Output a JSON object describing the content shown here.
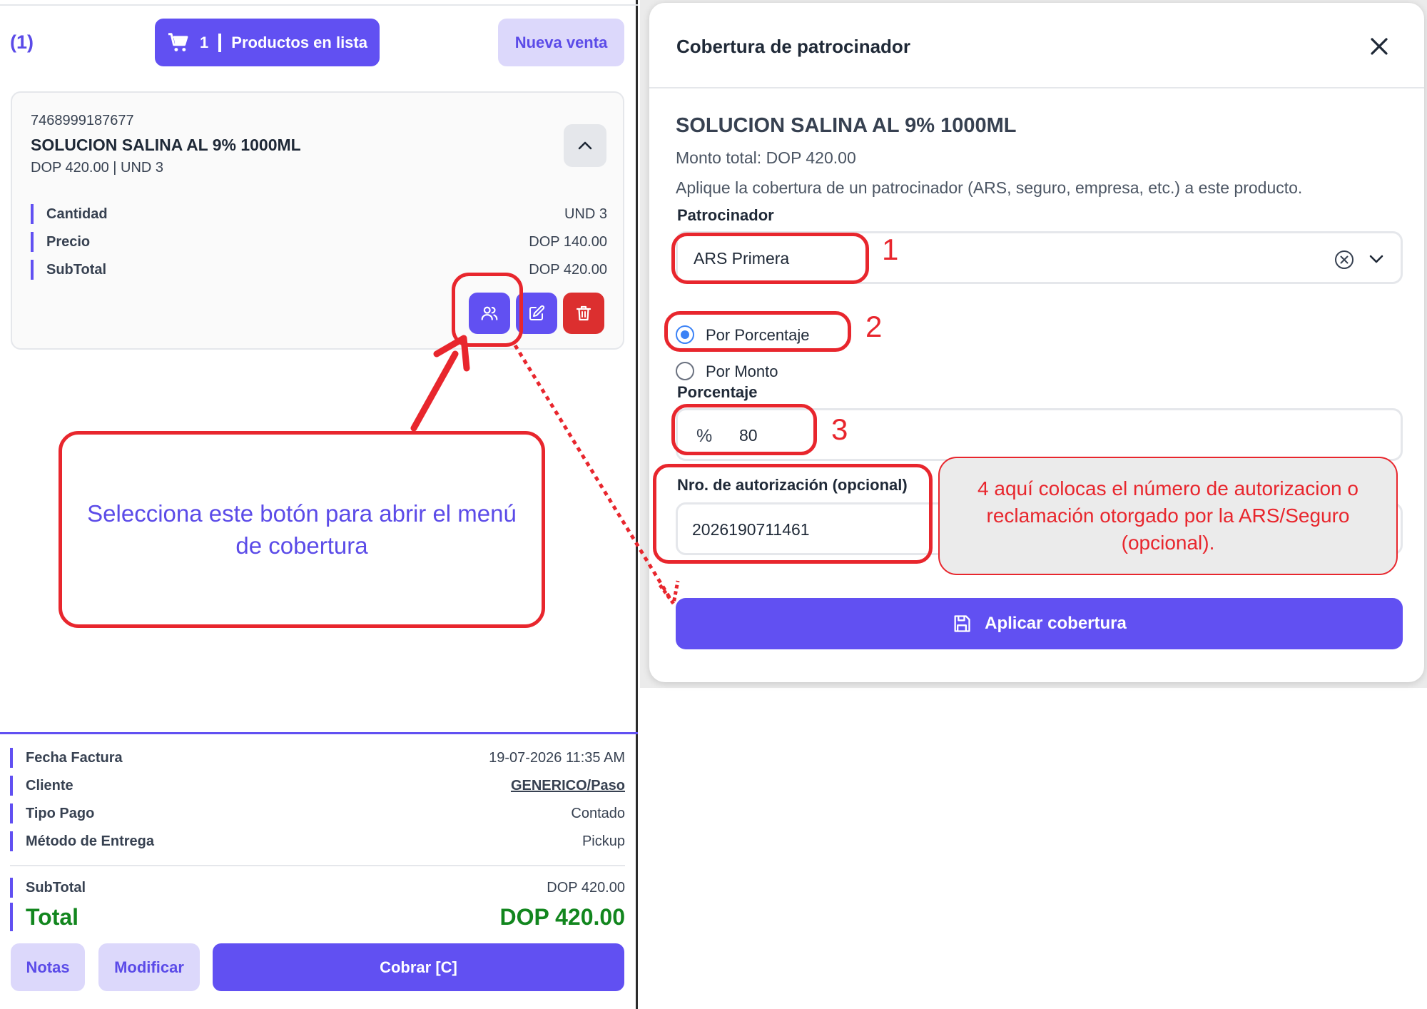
{
  "left": {
    "count": "(1)",
    "cart": {
      "count": "1",
      "label": "Productos en lista"
    },
    "new_sale": "Nueva venta",
    "product": {
      "barcode": "7468999187677",
      "name": "SOLUCION SALINA AL 9% 1000ML",
      "price_line": "DOP 420.00 | UND 3",
      "details": [
        {
          "label": "Cantidad",
          "value": "UND 3"
        },
        {
          "label": "Precio",
          "value": "DOP 140.00"
        },
        {
          "label": "SubTotal",
          "value": "DOP 420.00"
        }
      ]
    },
    "invoice": [
      {
        "label": "Fecha Factura",
        "value": "19-07-2026 11:35 AM"
      },
      {
        "label": "Cliente",
        "value": "GENERICO/Paso"
      },
      {
        "label": "Tipo Pago",
        "value": "Contado"
      },
      {
        "label": "Método de Entrega",
        "value": "Pickup"
      }
    ],
    "subtotal": {
      "label": "SubTotal",
      "value": "DOP 420.00"
    },
    "total": {
      "label": "Total",
      "value": "DOP 420.00"
    },
    "buttons": {
      "notes": "Notas",
      "modify": "Modificar",
      "charge": "Cobrar [C]"
    }
  },
  "modal": {
    "title": "Cobertura de patrocinador",
    "product_name": "SOLUCION SALINA AL 9% 1000ML",
    "total_line": "Monto total: DOP 420.00",
    "description": "Aplique la cobertura de un patrocinador (ARS, seguro, empresa, etc.) a este producto.",
    "sponsor_label": "Patrocinador",
    "sponsor_value": "ARS Primera",
    "options": [
      "Por Porcentaje",
      "Por Monto"
    ],
    "selected_option": "Por Porcentaje",
    "percentage_label": "Porcentaje",
    "percent_symbol": "%",
    "percentage_value": "80",
    "auth_label": "Nro. de autorización (opcional)",
    "auth_value": "2026190711461",
    "apply_label": "Aplicar cobertura"
  },
  "annotations": {
    "n1": "1",
    "n2": "2",
    "n3": "3",
    "note4": "4 aquí colocas el número de autorizacion o reclamación otorgado por la ARS/Seguro (opcional).",
    "left_note": "Selecciona este botón para abrir el menú de cobertura"
  },
  "colors": {
    "primary": "#6150f2",
    "annotation_red": "#e8262d",
    "total_green": "#12861e",
    "delete_red": "#dc2f2f"
  }
}
